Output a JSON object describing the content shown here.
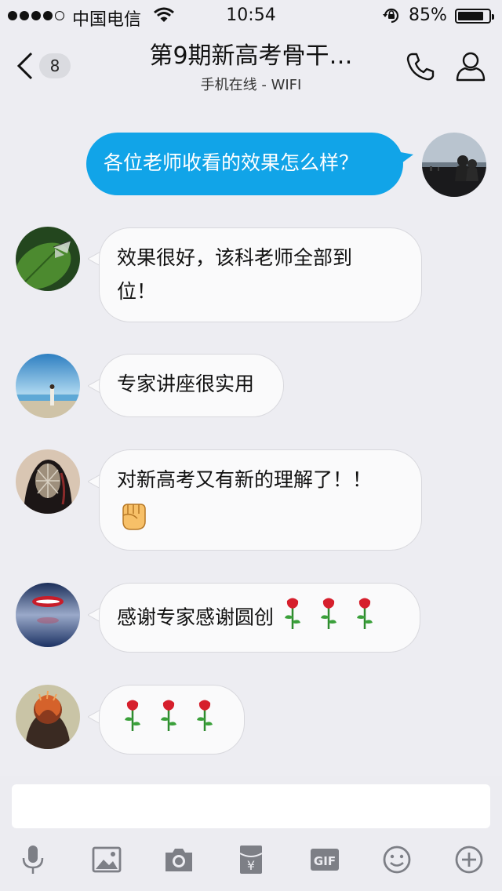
{
  "status_bar": {
    "carrier": "中国电信",
    "time": "10:54",
    "battery_percent": "85%",
    "battery_level": 0.85
  },
  "header": {
    "back_count": "8",
    "title": "第9期新高考骨干…",
    "subtitle": "手机在线 - WIFI"
  },
  "messages": [
    {
      "direction": "outgoing",
      "text": "各位老师收看的效果怎么样？",
      "avatar_icon": "two-people-silhouette-avatar"
    },
    {
      "direction": "incoming",
      "line1": "效果很好，该科老师全部到",
      "line2": "位！",
      "avatar_icon": "butterfly-leaf-avatar"
    },
    {
      "direction": "incoming",
      "text": "专家讲座很实用",
      "avatar_icon": "beach-person-avatar"
    },
    {
      "direction": "incoming",
      "text": "对新高考又有新的理解了！！",
      "emoji": "raised-fist-emoji",
      "avatar_icon": "feather-portrait-avatar"
    },
    {
      "direction": "incoming",
      "text": "感谢专家感谢圆创",
      "emoji": "rose-emoji x3",
      "avatar_icon": "red-lips-water-avatar"
    },
    {
      "direction": "incoming",
      "text": "",
      "emoji": "rose-emoji x3",
      "avatar_icon": "fiery-portrait-avatar"
    }
  ],
  "input": {
    "value": "",
    "placeholder": ""
  },
  "toolbar": {
    "gif_label": "GIF",
    "yen_label": "¥",
    "icons": [
      "microphone-icon",
      "image-icon",
      "camera-icon",
      "red-packet-icon",
      "gif-icon",
      "emoji-icon",
      "plus-icon"
    ]
  },
  "colors": {
    "background": "#ededf2",
    "outgoing_bubble": "#11a4e8",
    "incoming_bubble": "#fafafb",
    "icon_gray": "#7d7f86"
  }
}
